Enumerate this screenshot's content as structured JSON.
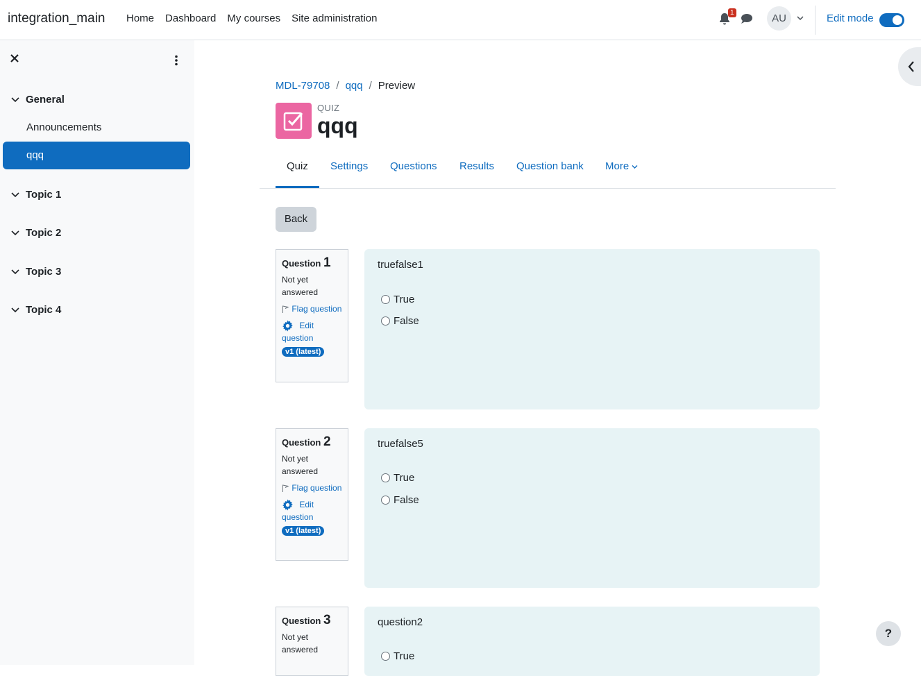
{
  "navbar": {
    "brand": "integration_main",
    "links": [
      "Home",
      "Dashboard",
      "My courses",
      "Site administration"
    ],
    "notification_count": "1",
    "avatar_initials": "AU",
    "edit_mode_label": "Edit mode",
    "edit_mode_on": true
  },
  "drawer": {
    "sections": [
      {
        "title": "General",
        "items": [
          {
            "label": "Announcements",
            "active": false
          },
          {
            "label": "qqq",
            "active": true
          }
        ]
      },
      {
        "title": "Topic 1"
      },
      {
        "title": "Topic 2"
      },
      {
        "title": "Topic 3"
      },
      {
        "title": "Topic 4"
      }
    ]
  },
  "breadcrumb": [
    "MDL-79708",
    "qqq",
    "Preview"
  ],
  "header": {
    "module_type": "QUIZ",
    "title": "qqq",
    "icon_color": "#eb66a2"
  },
  "tabs": [
    "Quiz",
    "Settings",
    "Questions",
    "Results",
    "Question bank",
    "More"
  ],
  "back_label": "Back",
  "questions": [
    {
      "label": "Question",
      "number": "1",
      "state": "Not yet answered",
      "flag": "Flag question",
      "edit": "Edit question",
      "version": "v1 (latest)",
      "text": "truefalse1",
      "options": [
        "True",
        "False"
      ]
    },
    {
      "label": "Question",
      "number": "2",
      "state": "Not yet answered",
      "flag": "Flag question",
      "edit": "Edit question",
      "version": "v1 (latest)",
      "text": "truefalse5",
      "options": [
        "True",
        "False"
      ]
    },
    {
      "label": "Question",
      "number": "3",
      "state": "Not yet answered",
      "text": "question2",
      "options": [
        "True"
      ]
    }
  ],
  "help_label": "?",
  "colors": {
    "accent": "#0f6cbf",
    "question_bg": "#e7f3f5",
    "badge_bg": "#ca3120"
  }
}
